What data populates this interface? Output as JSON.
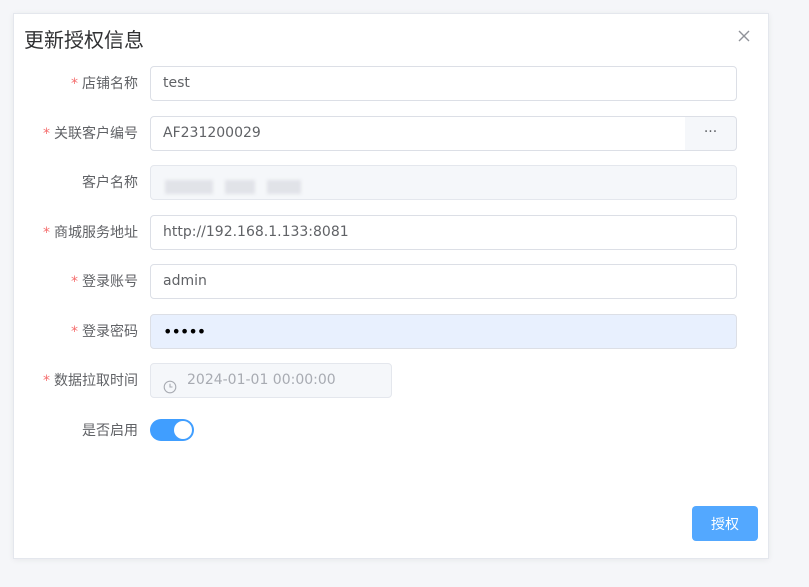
{
  "dialog": {
    "title": "更新授权信息",
    "close_icon": "close-icon"
  },
  "form": {
    "required_mark": "*",
    "store_name": {
      "label": "店铺名称",
      "value": "test",
      "required": true
    },
    "customer_code": {
      "label": "关联客户编号",
      "value": "AF231200029",
      "append": "···",
      "required": true
    },
    "customer_name": {
      "label": "客户名称",
      "value": "",
      "disabled": true,
      "required": false
    },
    "service_url": {
      "label": "商城服务地址",
      "value": "http://192.168.1.133:8081",
      "required": true
    },
    "login_account": {
      "label": "登录账号",
      "value": "admin",
      "required": true
    },
    "login_password": {
      "label": "登录密码",
      "value": "•••••",
      "required": true
    },
    "pull_time": {
      "label": "数据拉取时间",
      "value": "2024-01-01 00:00:00",
      "disabled": true,
      "required": true,
      "icon": "clock-icon"
    },
    "enabled": {
      "label": "是否启用",
      "value": true,
      "required": false
    }
  },
  "footer": {
    "authorize_label": "授权"
  },
  "colors": {
    "accent": "#409eff",
    "required": "#f56c6c"
  }
}
